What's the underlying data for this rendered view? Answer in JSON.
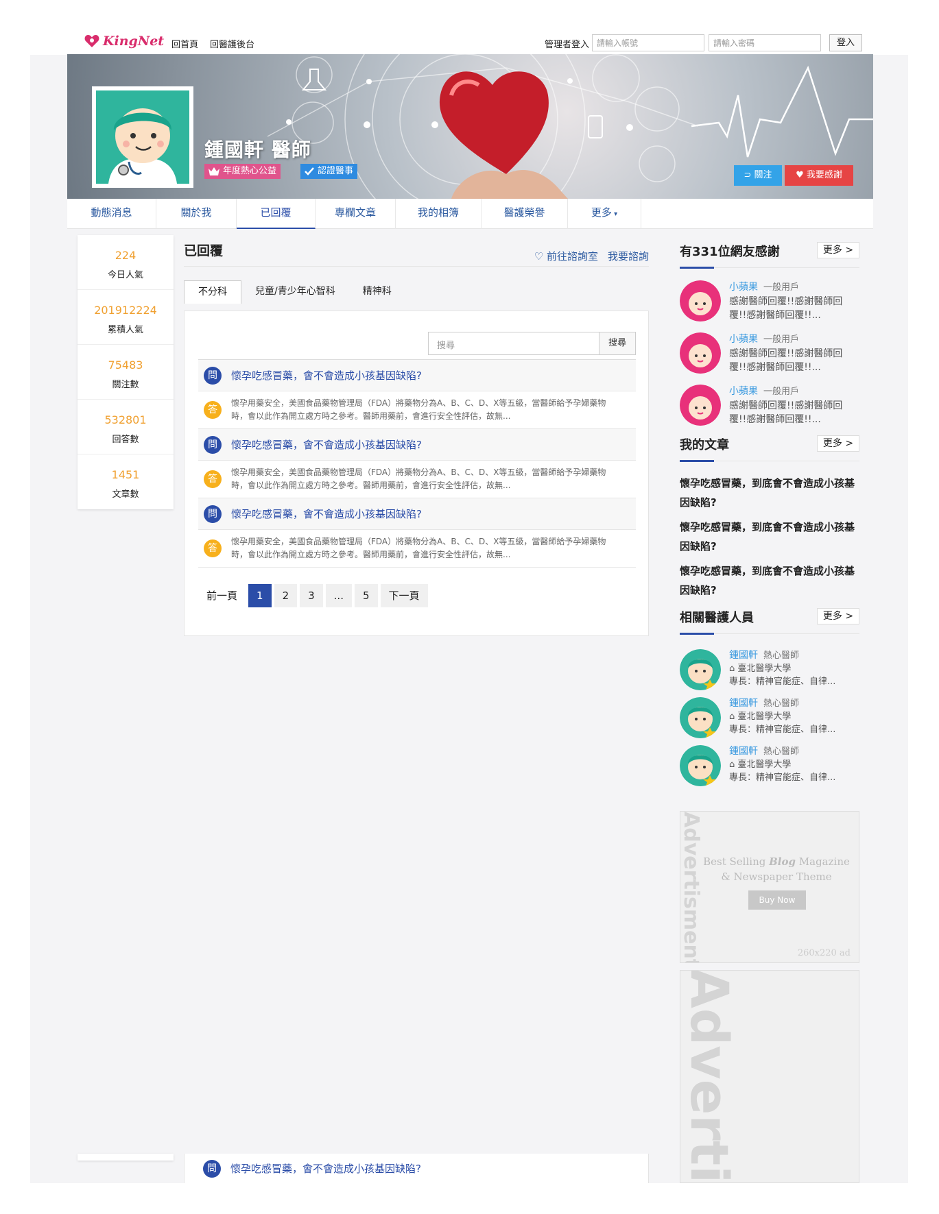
{
  "topbar": {
    "logo_text": "KingNet",
    "home_link": "回首頁",
    "backend_link": "回醫護後台",
    "admin_label": "管理者登入",
    "account_placeholder": "請輸入帳號",
    "password_placeholder": "請輸入密碼",
    "login_button": "登入"
  },
  "profile": {
    "name": "鍾國軒 醫師",
    "badge_public": "年度熱心公益",
    "badge_verified": "認證醫事",
    "follow_button": "關注",
    "thank_button": "我要感謝"
  },
  "nav": {
    "items": [
      "動態消息",
      "關於我",
      "已回覆",
      "專欄文章",
      "我的相簿",
      "醫護榮譽",
      "更多"
    ],
    "active_index": 2
  },
  "stats": [
    {
      "value": "224",
      "label": "今日人氣"
    },
    {
      "value": "201912224",
      "label": "累積人氣"
    },
    {
      "value": "75483",
      "label": "關注數"
    },
    {
      "value": "532801",
      "label": "回答數"
    },
    {
      "value": "1451",
      "label": "文章數"
    }
  ],
  "main": {
    "title": "已回覆",
    "consult_room_link": "前往諮詢室",
    "consult_link": "我要諮詢",
    "tabs": [
      "不分科",
      "兒童/青少年心智科",
      "精神科"
    ],
    "search_placeholder": "搜尋",
    "search_button": "搜尋",
    "q_mark": "問",
    "a_mark": "答",
    "qa": [
      {
        "question": "懷孕吃感冒藥，會不會造成小孩基因缺陷?",
        "answer": "懷孕用藥安全，美國食品藥物管理局（FDA）將藥物分為A、B、C、D、X等五級，當醫師給予孕婦藥物時，會以此作為開立處方時之參考。醫師用藥前，會進行安全性評估，故無..."
      },
      {
        "question": "懷孕吃感冒藥，會不會造成小孩基因缺陷?",
        "answer": "懷孕用藥安全，美國食品藥物管理局（FDA）將藥物分為A、B、C、D、X等五級，當醫師給予孕婦藥物時，會以此作為開立處方時之參考。醫師用藥前，會進行安全性評估，故無..."
      },
      {
        "question": "懷孕吃感冒藥，會不會造成小孩基因缺陷?",
        "answer": "懷孕用藥安全，美國食品藥物管理局（FDA）將藥物分為A、B、C、D、X等五級，當醫師給予孕婦藥物時，會以此作為開立處方時之參考。醫師用藥前，會進行安全性評估，故無..."
      }
    ],
    "pager": {
      "prev": "前一頁",
      "pages": [
        "1",
        "2",
        "3",
        "...",
        "5"
      ],
      "next": "下一頁",
      "current": "1"
    },
    "bottom_question": "懷孕吃感冒藥，會不會造成小孩基因缺陷?"
  },
  "right": {
    "thanks_title": "有331位網友感謝",
    "more_label": "更多 >",
    "thanks": [
      {
        "name": "小蘋果",
        "role": "一般用戶",
        "msg": "感謝醫師回覆!!感謝醫師回覆!!感謝醫師回覆!!..."
      },
      {
        "name": "小蘋果",
        "role": "一般用戶",
        "msg": "感謝醫師回覆!!感謝醫師回覆!!感謝醫師回覆!!..."
      },
      {
        "name": "小蘋果",
        "role": "一般用戶",
        "msg": "感謝醫師回覆!!感謝醫師回覆!!感謝醫師回覆!!..."
      }
    ],
    "articles_title": "我的文章",
    "articles": [
      "懷孕吃感冒藥，到底會不會造成小孩基因缺陷?",
      "懷孕吃感冒藥，到底會不會造成小孩基因缺陷?",
      "懷孕吃感冒藥，到底會不會造成小孩基因缺陷?"
    ],
    "staff_title": "相關醫護人員",
    "staff": [
      {
        "name": "鍾國軒",
        "role": "熱心醫師",
        "school": "臺北醫學大學",
        "specialty": "專長：精神官能症、自律..."
      },
      {
        "name": "鍾國軒",
        "role": "熱心醫師",
        "school": "臺北醫學大學",
        "specialty": "專長：精神官能症、自律..."
      },
      {
        "name": "鍾國軒",
        "role": "熱心醫師",
        "school": "臺北醫學大學",
        "specialty": "專長：精神官能症、自律..."
      }
    ],
    "ad1": {
      "vertical": "Advertisment",
      "line1_pre": "Best Selling ",
      "line1_em": "Blog",
      "line1_post": " Magazine",
      "line2": "& Newspaper Theme",
      "button": "Buy Now",
      "size": "260x220 ad"
    },
    "ad2": {
      "vertical": "Advertism"
    }
  }
}
